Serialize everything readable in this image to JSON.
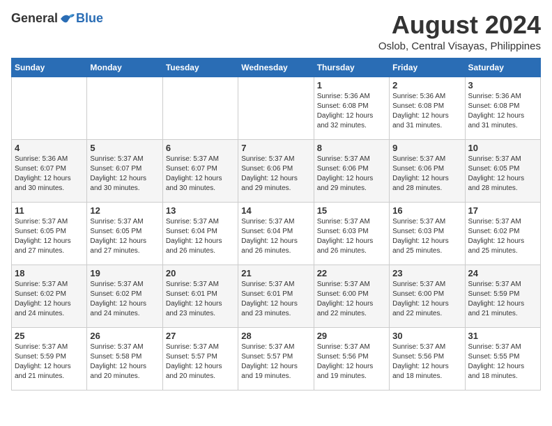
{
  "logo": {
    "general": "General",
    "blue": "Blue"
  },
  "header": {
    "month": "August 2024",
    "location": "Oslob, Central Visayas, Philippines"
  },
  "weekdays": [
    "Sunday",
    "Monday",
    "Tuesday",
    "Wednesday",
    "Thursday",
    "Friday",
    "Saturday"
  ],
  "weeks": [
    [
      {
        "day": "",
        "sunrise": "",
        "sunset": "",
        "daylight": ""
      },
      {
        "day": "",
        "sunrise": "",
        "sunset": "",
        "daylight": ""
      },
      {
        "day": "",
        "sunrise": "",
        "sunset": "",
        "daylight": ""
      },
      {
        "day": "",
        "sunrise": "",
        "sunset": "",
        "daylight": ""
      },
      {
        "day": "1",
        "sunrise": "Sunrise: 5:36 AM",
        "sunset": "Sunset: 6:08 PM",
        "daylight": "Daylight: 12 hours and 32 minutes."
      },
      {
        "day": "2",
        "sunrise": "Sunrise: 5:36 AM",
        "sunset": "Sunset: 6:08 PM",
        "daylight": "Daylight: 12 hours and 31 minutes."
      },
      {
        "day": "3",
        "sunrise": "Sunrise: 5:36 AM",
        "sunset": "Sunset: 6:08 PM",
        "daylight": "Daylight: 12 hours and 31 minutes."
      }
    ],
    [
      {
        "day": "4",
        "sunrise": "Sunrise: 5:36 AM",
        "sunset": "Sunset: 6:07 PM",
        "daylight": "Daylight: 12 hours and 30 minutes."
      },
      {
        "day": "5",
        "sunrise": "Sunrise: 5:37 AM",
        "sunset": "Sunset: 6:07 PM",
        "daylight": "Daylight: 12 hours and 30 minutes."
      },
      {
        "day": "6",
        "sunrise": "Sunrise: 5:37 AM",
        "sunset": "Sunset: 6:07 PM",
        "daylight": "Daylight: 12 hours and 30 minutes."
      },
      {
        "day": "7",
        "sunrise": "Sunrise: 5:37 AM",
        "sunset": "Sunset: 6:06 PM",
        "daylight": "Daylight: 12 hours and 29 minutes."
      },
      {
        "day": "8",
        "sunrise": "Sunrise: 5:37 AM",
        "sunset": "Sunset: 6:06 PM",
        "daylight": "Daylight: 12 hours and 29 minutes."
      },
      {
        "day": "9",
        "sunrise": "Sunrise: 5:37 AM",
        "sunset": "Sunset: 6:06 PM",
        "daylight": "Daylight: 12 hours and 28 minutes."
      },
      {
        "day": "10",
        "sunrise": "Sunrise: 5:37 AM",
        "sunset": "Sunset: 6:05 PM",
        "daylight": "Daylight: 12 hours and 28 minutes."
      }
    ],
    [
      {
        "day": "11",
        "sunrise": "Sunrise: 5:37 AM",
        "sunset": "Sunset: 6:05 PM",
        "daylight": "Daylight: 12 hours and 27 minutes."
      },
      {
        "day": "12",
        "sunrise": "Sunrise: 5:37 AM",
        "sunset": "Sunset: 6:05 PM",
        "daylight": "Daylight: 12 hours and 27 minutes."
      },
      {
        "day": "13",
        "sunrise": "Sunrise: 5:37 AM",
        "sunset": "Sunset: 6:04 PM",
        "daylight": "Daylight: 12 hours and 26 minutes."
      },
      {
        "day": "14",
        "sunrise": "Sunrise: 5:37 AM",
        "sunset": "Sunset: 6:04 PM",
        "daylight": "Daylight: 12 hours and 26 minutes."
      },
      {
        "day": "15",
        "sunrise": "Sunrise: 5:37 AM",
        "sunset": "Sunset: 6:03 PM",
        "daylight": "Daylight: 12 hours and 26 minutes."
      },
      {
        "day": "16",
        "sunrise": "Sunrise: 5:37 AM",
        "sunset": "Sunset: 6:03 PM",
        "daylight": "Daylight: 12 hours and 25 minutes."
      },
      {
        "day": "17",
        "sunrise": "Sunrise: 5:37 AM",
        "sunset": "Sunset: 6:02 PM",
        "daylight": "Daylight: 12 hours and 25 minutes."
      }
    ],
    [
      {
        "day": "18",
        "sunrise": "Sunrise: 5:37 AM",
        "sunset": "Sunset: 6:02 PM",
        "daylight": "Daylight: 12 hours and 24 minutes."
      },
      {
        "day": "19",
        "sunrise": "Sunrise: 5:37 AM",
        "sunset": "Sunset: 6:02 PM",
        "daylight": "Daylight: 12 hours and 24 minutes."
      },
      {
        "day": "20",
        "sunrise": "Sunrise: 5:37 AM",
        "sunset": "Sunset: 6:01 PM",
        "daylight": "Daylight: 12 hours and 23 minutes."
      },
      {
        "day": "21",
        "sunrise": "Sunrise: 5:37 AM",
        "sunset": "Sunset: 6:01 PM",
        "daylight": "Daylight: 12 hours and 23 minutes."
      },
      {
        "day": "22",
        "sunrise": "Sunrise: 5:37 AM",
        "sunset": "Sunset: 6:00 PM",
        "daylight": "Daylight: 12 hours and 22 minutes."
      },
      {
        "day": "23",
        "sunrise": "Sunrise: 5:37 AM",
        "sunset": "Sunset: 6:00 PM",
        "daylight": "Daylight: 12 hours and 22 minutes."
      },
      {
        "day": "24",
        "sunrise": "Sunrise: 5:37 AM",
        "sunset": "Sunset: 5:59 PM",
        "daylight": "Daylight: 12 hours and 21 minutes."
      }
    ],
    [
      {
        "day": "25",
        "sunrise": "Sunrise: 5:37 AM",
        "sunset": "Sunset: 5:59 PM",
        "daylight": "Daylight: 12 hours and 21 minutes."
      },
      {
        "day": "26",
        "sunrise": "Sunrise: 5:37 AM",
        "sunset": "Sunset: 5:58 PM",
        "daylight": "Daylight: 12 hours and 20 minutes."
      },
      {
        "day": "27",
        "sunrise": "Sunrise: 5:37 AM",
        "sunset": "Sunset: 5:57 PM",
        "daylight": "Daylight: 12 hours and 20 minutes."
      },
      {
        "day": "28",
        "sunrise": "Sunrise: 5:37 AM",
        "sunset": "Sunset: 5:57 PM",
        "daylight": "Daylight: 12 hours and 19 minutes."
      },
      {
        "day": "29",
        "sunrise": "Sunrise: 5:37 AM",
        "sunset": "Sunset: 5:56 PM",
        "daylight": "Daylight: 12 hours and 19 minutes."
      },
      {
        "day": "30",
        "sunrise": "Sunrise: 5:37 AM",
        "sunset": "Sunset: 5:56 PM",
        "daylight": "Daylight: 12 hours and 18 minutes."
      },
      {
        "day": "31",
        "sunrise": "Sunrise: 5:37 AM",
        "sunset": "Sunset: 5:55 PM",
        "daylight": "Daylight: 12 hours and 18 minutes."
      }
    ]
  ]
}
